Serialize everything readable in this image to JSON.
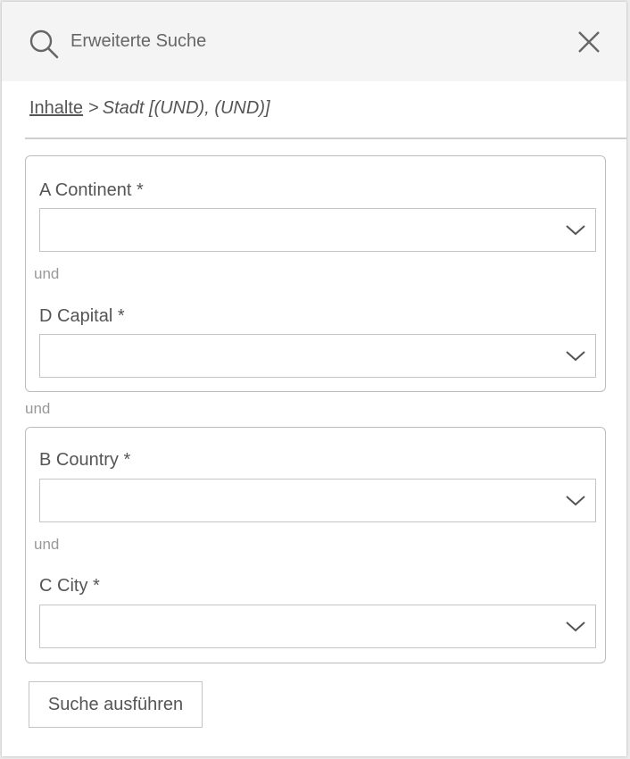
{
  "header": {
    "title": "Erweiterte Suche",
    "search_icon": "search-icon",
    "close_icon": "close-icon"
  },
  "breadcrumb": {
    "link": "Inhalte",
    "separator": ">",
    "current": "Stadt [(UND), (UND)]"
  },
  "groups": [
    {
      "fields": [
        {
          "label": "A Continent *",
          "value": ""
        },
        {
          "label": "D Capital *",
          "value": ""
        }
      ],
      "connector": "und"
    },
    {
      "fields": [
        {
          "label": "B Country *",
          "value": ""
        },
        {
          "label": "C City *",
          "value": ""
        }
      ],
      "connector": "und"
    }
  ],
  "group_connector": "und",
  "actions": {
    "run_label": "Suche ausführen"
  }
}
